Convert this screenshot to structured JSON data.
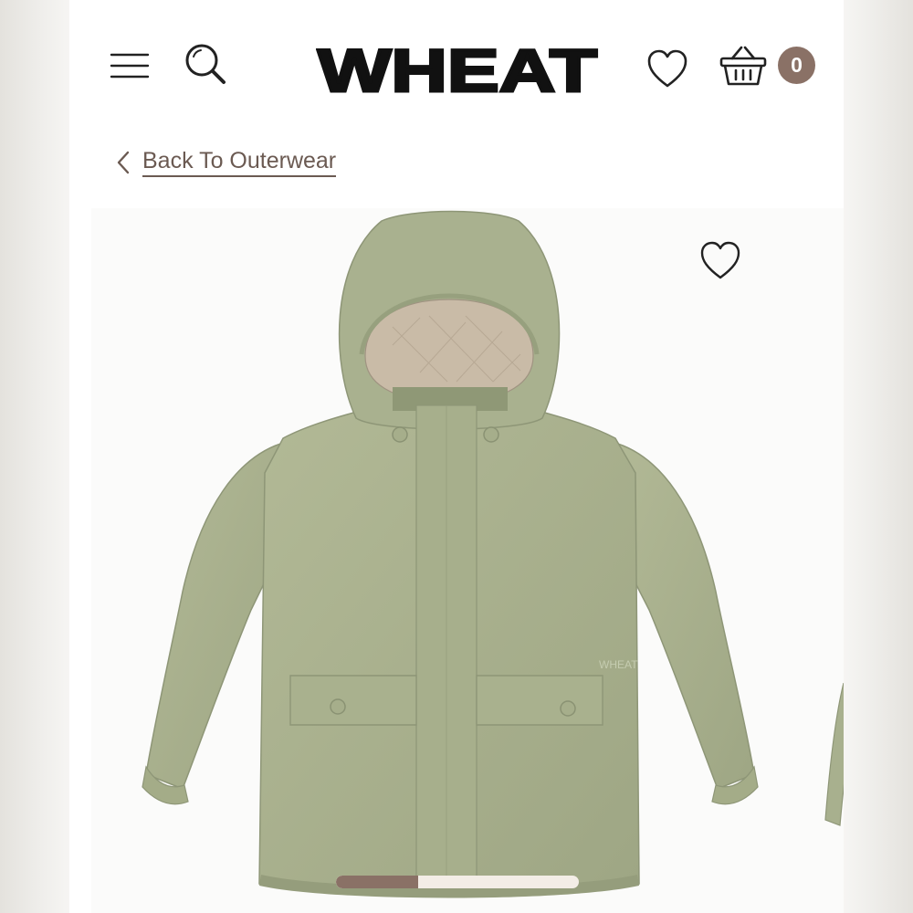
{
  "header": {
    "logo_text": "WHEAT",
    "cart_count": "0"
  },
  "nav": {
    "back_label": "Back To Outerwear"
  },
  "product": {
    "image_alt": "Olive green rain jacket with hood",
    "jacket_brand_print": "WHEAT"
  },
  "carousel": {
    "progress": 0.34
  },
  "colors": {
    "brand": "#111111",
    "accent": "#8a7166",
    "jacket": "#a8b08e"
  },
  "icons": {
    "menu": "menu-icon",
    "search": "search-icon",
    "wishlist": "heart-icon",
    "cart": "basket-icon",
    "back": "chevron-left-icon"
  }
}
